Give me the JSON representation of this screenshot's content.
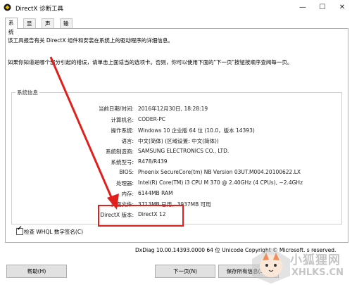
{
  "window": {
    "title": "DirectX 诊断工具",
    "controls": {
      "minimize": "—",
      "maximize": "☐",
      "close": "✕"
    }
  },
  "tabs": [
    {
      "label": "系统",
      "active": true
    },
    {
      "label": "显示",
      "active": false
    },
    {
      "label": "声音",
      "active": false
    },
    {
      "label": "输入",
      "active": false
    }
  ],
  "intro": {
    "line1": "该工具报告有关 DirectX 组件和安装在系统上的驱动程序的详细信息。",
    "line2": "如果你知道是哪个部分引起的错误，请单击上面适当的选项卡。否则，你可以使用下面的\"下一页\"按钮按顺序查阅每一页。"
  },
  "system_info": {
    "group_title": "系统信息",
    "rows": [
      {
        "label": "当前日期/时间:",
        "value": "2016年12月30日, 18:28:19"
      },
      {
        "label": "计算机名:",
        "value": "CODER-PC"
      },
      {
        "label": "操作系统:",
        "value": "Windows 10 企业版 64 位 (10.0，版本 14393)"
      },
      {
        "label": "语言:",
        "value": "中文(简体) (区域设置: 中文(简体))"
      },
      {
        "label": "系统制造商:",
        "value": "SAMSUNG ELECTRONICS CO., LTD."
      },
      {
        "label": "系统型号:",
        "value": "R478/R439"
      },
      {
        "label": "BIOS:",
        "value": "Phoenix SecureCore(tm) NB Version 03UT.M004.20100622.LX"
      },
      {
        "label": "处理器:",
        "value": "Intel(R) Core(TM) i3 CPU       M 370  @ 2.40GHz (4 CPUs), ~2.4GHz"
      },
      {
        "label": "内存:",
        "value": "6144MB RAM"
      },
      {
        "label": "页面文件:",
        "value": "3713MB 已用，3937MB 可用"
      },
      {
        "label": "DirectX 版本:",
        "value": "DirectX 12"
      }
    ]
  },
  "whql": {
    "label": "检查 WHQL 数字签名(C)",
    "checked": true
  },
  "footer": {
    "text": "DxDiag 10.00.14393.0000 64 位 Unicode  Copyright © Microsoft.    s reserved."
  },
  "buttons": {
    "help": "帮助(H)",
    "next": "下一页(N)",
    "save": "保存所有信息(S)..."
  },
  "watermark": {
    "big": "小狐狸网",
    "small": "XHLKS.CN"
  },
  "colors": {
    "highlight": "#e0201c",
    "arrow": "#e0201c"
  }
}
